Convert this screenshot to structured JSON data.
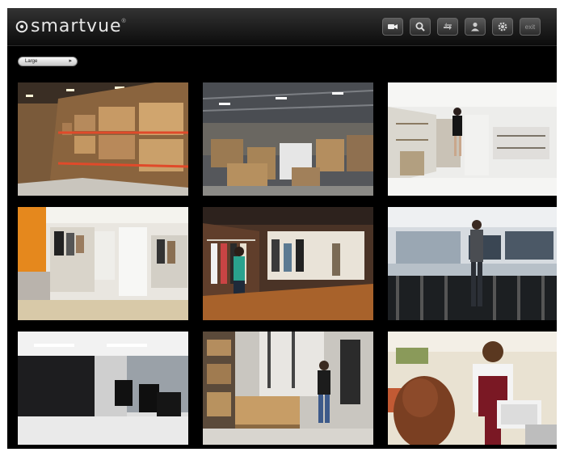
{
  "app": {
    "brand": "smartvue",
    "brand_mark": "®"
  },
  "toolbar": {
    "buttons": [
      {
        "name": "camera-view-button",
        "icon": "video-camera-icon"
      },
      {
        "name": "search-button",
        "icon": "magnifier-icon"
      },
      {
        "name": "share-button",
        "icon": "arrows-icon"
      },
      {
        "name": "user-button",
        "icon": "user-icon"
      },
      {
        "name": "settings-button",
        "icon": "gear-icon"
      },
      {
        "name": "exit-button",
        "icon": "exit-icon",
        "label": "exit"
      }
    ]
  },
  "layout_selector": {
    "value": "Large"
  },
  "cameras": [
    {
      "scene": "warehouse-aisle-boxes"
    },
    {
      "scene": "warehouse-floor-pallets"
    },
    {
      "scene": "retail-store-white-shelves"
    },
    {
      "scene": "clothing-boutique-orange-wall"
    },
    {
      "scene": "clothing-store-shoppers"
    },
    {
      "scene": "electronics-store-shopper"
    },
    {
      "scene": "office-lobby-lounge"
    },
    {
      "scene": "stockroom-worker-pallet"
    },
    {
      "scene": "checkout-counter-cashier"
    }
  ],
  "colors": {
    "background": "#000000",
    "header_top": "#333333",
    "header_bottom": "#0c0c0c",
    "brand_text": "#e6e6e6"
  }
}
